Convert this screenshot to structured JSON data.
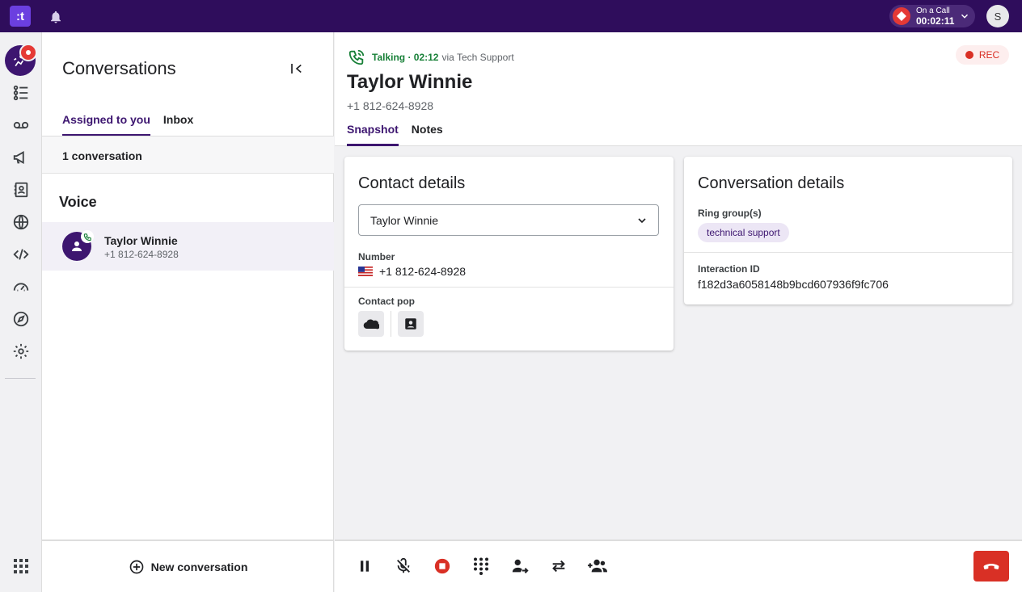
{
  "topbar": {
    "logo_text": ":t",
    "oncall_label": "On a Call",
    "oncall_timer": "00:02:11",
    "user_initial": "S"
  },
  "conversations": {
    "title": "Conversations",
    "tabs": [
      "Assigned to you",
      "Inbox"
    ],
    "count_label": "1 conversation",
    "section": "Voice",
    "item": {
      "name": "Taylor Winnie",
      "number": "+1 812-624-8928"
    },
    "new_label": "New conversation"
  },
  "call": {
    "status": "Talking · 02:12",
    "via": "via Tech Support",
    "rec_label": "REC",
    "contact_name": "Taylor Winnie",
    "contact_number": "+1 812-624-8928",
    "tabs": [
      "Snapshot",
      "Notes"
    ]
  },
  "contact_details": {
    "title": "Contact details",
    "selected_contact": "Taylor Winnie",
    "number_label": "Number",
    "number": "+1 812-624-8928",
    "pop_label": "Contact pop"
  },
  "conversation_details": {
    "title": "Conversation details",
    "ring_label": "Ring group(s)",
    "ring_group": "technical support",
    "iid_label": "Interaction ID",
    "iid": "f182d3a6058148b9bcd607936f9fc706"
  },
  "colors": {
    "brand_dark": "#2f0d5c",
    "accent": "#3d1670",
    "talking_green": "#188038",
    "danger": "#d93025"
  }
}
